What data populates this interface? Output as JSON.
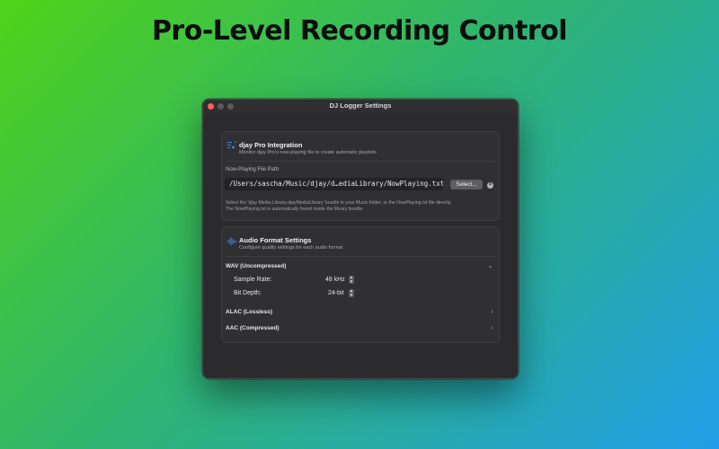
{
  "headline": "Pro-Level Recording Control",
  "window": {
    "title": "DJ Logger Settings"
  },
  "djay": {
    "title": "djay Pro Integration",
    "subtitle": "Monitor djay Pro's now-playing file to create automatic playlists",
    "path_label": "Now-Playing File Path",
    "path_value": "/Users/sascha/Music/djay/d…ediaLibrary/NowPlaying.txt",
    "select_label": "Select...",
    "help_line1": "Select the 'djay Media Library.djayMediaLibrary' bundle in your Music folder, or the NowPlaying.txt file directly.",
    "help_line2": "The NowPlaying.txt is automatically found inside the library bundle."
  },
  "audio": {
    "title": "Audio Format Settings",
    "subtitle": "Configure quality settings for each audio format",
    "formats": [
      {
        "label": "WAV (Uncompressed)",
        "expanded": true
      },
      {
        "label": "ALAC (Lossless)",
        "expanded": false
      },
      {
        "label": "AAC (Compressed)",
        "expanded": false
      }
    ],
    "wav_settings": {
      "sample_rate_label": "Sample Rate:",
      "sample_rate_value": "48 kHz",
      "bit_depth_label": "Bit Depth:",
      "bit_depth_value": "24-bit"
    }
  },
  "colors": {
    "accent": "#3a7bd5",
    "close_button": "#ff5f57"
  },
  "icons": {
    "djay": "music-note-list-icon",
    "audio": "waveform-icon"
  }
}
